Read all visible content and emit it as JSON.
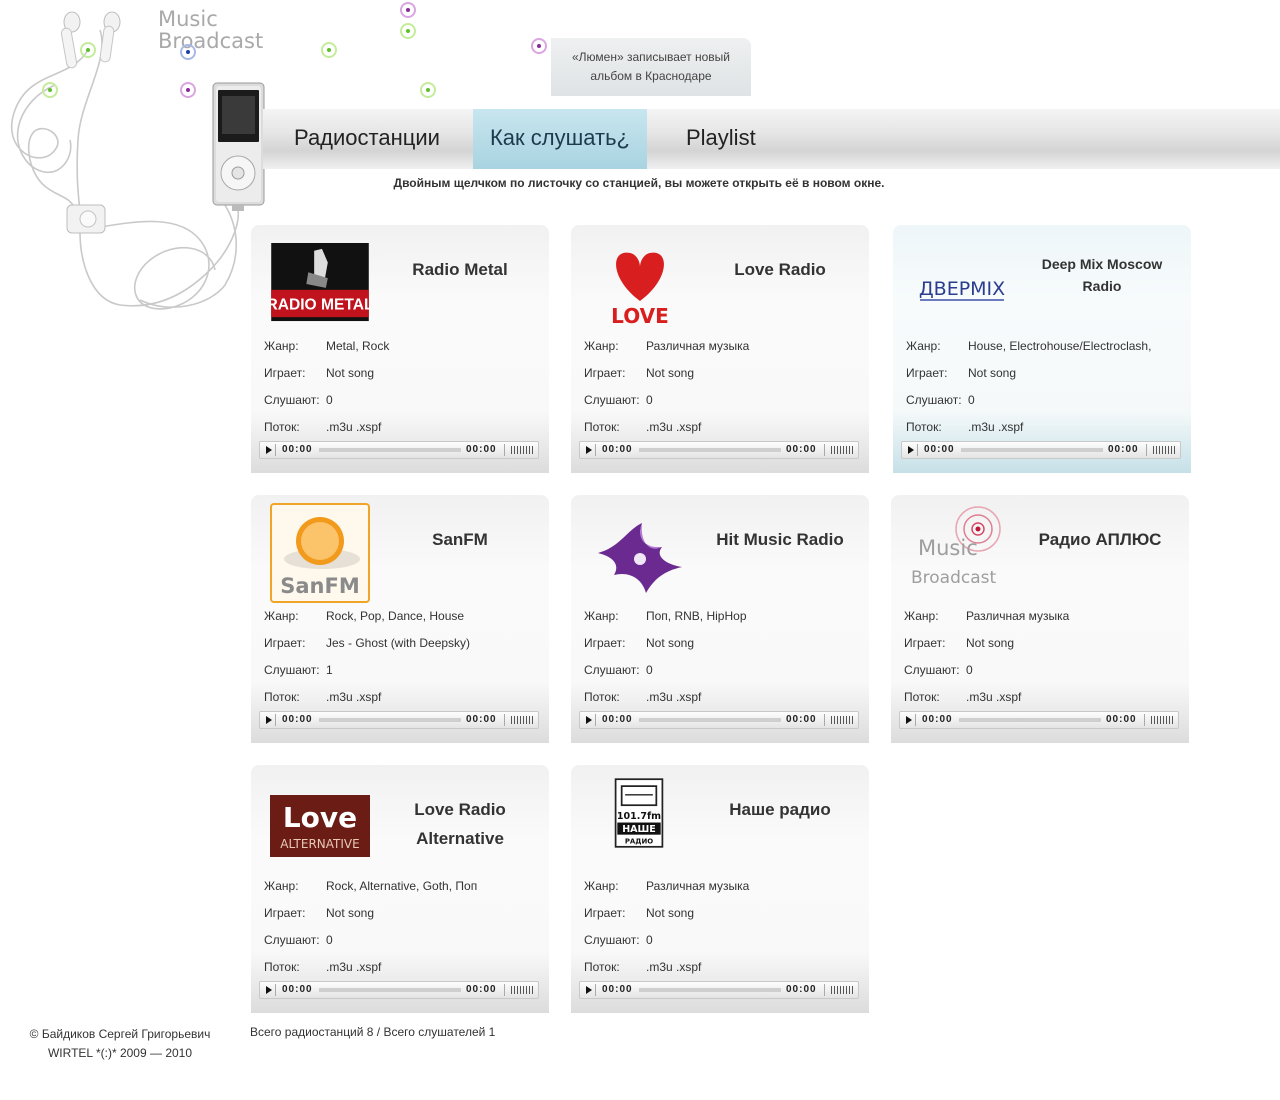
{
  "brand": {
    "line1": "Music",
    "line2": "Broadcast"
  },
  "news": {
    "line1": "«Люмен» записывает новый",
    "line2": "альбом в Краснодаре"
  },
  "nav": [
    {
      "label": "Радиостанции"
    },
    {
      "label": "Как слушать¿"
    },
    {
      "label": "Playlist"
    }
  ],
  "hint": "Двойным щелчком по листочку со станцией, вы можете открыть её в новом окне.",
  "labels": {
    "genre": "Жанр:",
    "playing": "Играет:",
    "listeners": "Слушают:",
    "stream": "Поток:"
  },
  "player": {
    "time_start": "00:00",
    "time_end": "00:00"
  },
  "stations": [
    {
      "name": "Radio Metal",
      "genre": "Metal, Rock",
      "playing": "Not song",
      "listeners": "0",
      "stream": ".m3u .xspf",
      "logo_text": "RADIO METAL"
    },
    {
      "name": "Love Radio",
      "genre": "Различная музыка",
      "playing": "Not song",
      "listeners": "0",
      "stream": ".m3u .xspf",
      "logo_text": "LOVE"
    },
    {
      "name": "Deep Mix Moscow Radio",
      "genre": "House, Electrohouse/Electroclash,",
      "playing": "Not song",
      "listeners": "0",
      "stream": ".m3u .xspf",
      "logo_text": "ДВЕРMIX"
    },
    {
      "name": "SanFM",
      "genre": "Rock, Pop, Dance, House",
      "playing": "Jes - Ghost (with Deepsky)",
      "listeners": "1",
      "stream": ".m3u .xspf",
      "logo_text": "SanFM"
    },
    {
      "name": "Hit Music Radio",
      "genre": "Поп, RNB, HipHop",
      "playing": "Not song",
      "listeners": "0",
      "stream": ".m3u .xspf"
    },
    {
      "name": "Радио АПЛЮС",
      "genre": "Различная музыка",
      "playing": "Not song",
      "listeners": "0",
      "stream": ".m3u .xspf",
      "logo_text_1": "Music",
      "logo_text_2": "Broadcast"
    },
    {
      "name_1": "Love Radio",
      "name_2": "Alternative",
      "genre": "Rock, Alternative, Goth, Поп",
      "playing": "Not song",
      "listeners": "0",
      "stream": ".m3u .xspf",
      "logo_text_1": "Love",
      "logo_text_2": "ALTERNATIVE"
    },
    {
      "name": "Наше радио",
      "genre": "Различная музыка",
      "playing": "Not song",
      "listeners": "0",
      "stream": ".m3u .xspf",
      "logo_text_1": "101.7fm",
      "logo_text_2": "НАШЕ",
      "logo_text_3": "РАДИО"
    }
  ],
  "footer": {
    "copyright": "© Байдиков Сергей Григорьевич",
    "company": "WIRTEL *(:)* 2009 — 2010",
    "totals": "Всего радиостанций 8 / Всего слушателей 1"
  },
  "colors": {
    "nav_active": "#a9d3e1",
    "accent_green": "#5fbf2a",
    "accent_purple": "#8b2a9a"
  }
}
